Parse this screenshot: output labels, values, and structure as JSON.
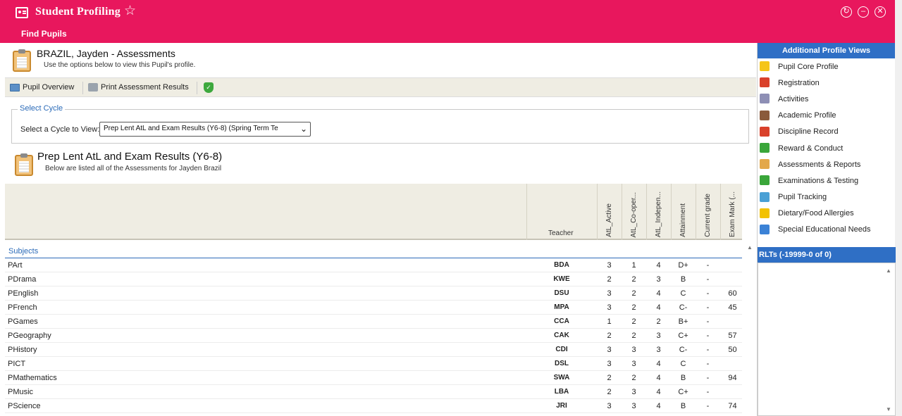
{
  "header": {
    "app_title": "Student Profiling",
    "nav_link": "Find Pupils",
    "refresh_symbol": "↻",
    "minimize_symbol": "–",
    "close_symbol": "✕"
  },
  "pupil": {
    "title": "BRAZIL, Jayden - Assessments",
    "subtitle": "Use the options below to view this Pupil's profile."
  },
  "toolbar": {
    "overview_label": "Pupil Overview",
    "print_label": "Print Assessment Results",
    "shield_symbol": "✓"
  },
  "cycle": {
    "legend": "Select Cycle",
    "label": "Select a Cycle to View:",
    "selected": "Prep Lent AtL and Exam Results (Y6-8) (Spring Term Te",
    "chevron": "⌄"
  },
  "section": {
    "title": "Prep Lent AtL and Exam Results (Y6-8)",
    "subtitle": "Below are listed all of the Assessments for Jayden Brazil"
  },
  "table": {
    "teacher_header": "Teacher",
    "columns": [
      "AtL_Active",
      "AtL_Co-oper...",
      "AtL_Indepen...",
      "Attainment",
      "Current grade",
      "Exam Mark (..."
    ],
    "group_label": "Subjects",
    "rows": [
      {
        "subject": "PArt",
        "teacher": "BDA",
        "values": [
          "3",
          "1",
          "4",
          "D+",
          "-",
          ""
        ]
      },
      {
        "subject": "PDrama",
        "teacher": "KWE",
        "values": [
          "2",
          "2",
          "3",
          "B",
          "-",
          ""
        ]
      },
      {
        "subject": "PEnglish",
        "teacher": "DSU",
        "values": [
          "3",
          "2",
          "4",
          "C",
          "-",
          "60"
        ]
      },
      {
        "subject": "PFrench",
        "teacher": "MPA",
        "values": [
          "3",
          "2",
          "4",
          "C-",
          "-",
          "45"
        ]
      },
      {
        "subject": "PGames",
        "teacher": "CCA",
        "values": [
          "1",
          "2",
          "2",
          "B+",
          "-",
          ""
        ]
      },
      {
        "subject": "PGeography",
        "teacher": "CAK",
        "values": [
          "2",
          "2",
          "3",
          "C+",
          "-",
          "57"
        ]
      },
      {
        "subject": "PHistory",
        "teacher": "CDI",
        "values": [
          "3",
          "3",
          "3",
          "C-",
          "-",
          "50"
        ]
      },
      {
        "subject": "PICT",
        "teacher": "DSL",
        "values": [
          "3",
          "3",
          "4",
          "C",
          "-",
          ""
        ]
      },
      {
        "subject": "PMathematics",
        "teacher": "SWA",
        "values": [
          "2",
          "2",
          "4",
          "B",
          "-",
          "94"
        ]
      },
      {
        "subject": "PMusic",
        "teacher": "LBA",
        "values": [
          "2",
          "3",
          "4",
          "C+",
          "-",
          ""
        ]
      },
      {
        "subject": "PScience",
        "teacher": "JRI",
        "values": [
          "3",
          "3",
          "4",
          "B",
          "-",
          "74"
        ]
      }
    ]
  },
  "right_panel": {
    "title": "Additional Profile Views",
    "items": [
      {
        "label": "Pupil Core Profile",
        "icon": "star-icon",
        "color": "#f5c518"
      },
      {
        "label": "Registration",
        "icon": "clock-icon",
        "color": "#d9412b"
      },
      {
        "label": "Activities",
        "icon": "masks-icon",
        "color": "#8e8fb5"
      },
      {
        "label": "Academic Profile",
        "icon": "graduate-icon",
        "color": "#8a5a3c"
      },
      {
        "label": "Discipline Record",
        "icon": "discipline-icon",
        "color": "#d9412b"
      },
      {
        "label": "Reward & Conduct",
        "icon": "check-icon",
        "color": "#3aa63a"
      },
      {
        "label": "Assessments & Reports",
        "icon": "clipboard-icon",
        "color": "#e3a84a"
      },
      {
        "label": "Examinations & Testing",
        "icon": "exam-icon",
        "color": "#3aa63a"
      },
      {
        "label": "Pupil Tracking",
        "icon": "chart-icon",
        "color": "#4aa0d5"
      },
      {
        "label": "Dietary/Food Allergies",
        "icon": "warning-icon",
        "color": "#f2c200"
      },
      {
        "label": "Special Educational Needs",
        "icon": "sen-icon",
        "color": "#3b82d6"
      }
    ],
    "rlt_title": "RLTs (-19999-0 of 0)"
  },
  "colors": {
    "header": "#e8175d",
    "panel_header": "#2f6fc5",
    "link": "#2a6ab8"
  }
}
